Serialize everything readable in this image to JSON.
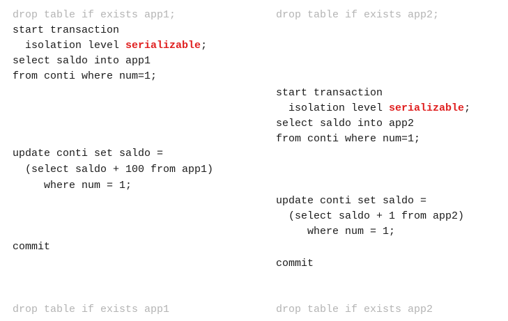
{
  "left": {
    "drop_top": "drop table if exists app1;",
    "start_transaction": "start transaction",
    "isolation_prefix": "  isolation level ",
    "isolation_keyword": "serializable",
    "isolation_suffix": ";",
    "select_into": "select saldo into app1",
    "from_where": "from conti where num=1;",
    "update": "update conti set saldo =",
    "subselect": "  (select saldo + 100 from app1)",
    "where": "     where num = 1;",
    "commit": "commit",
    "drop_bottom": "drop table if exists app1"
  },
  "right": {
    "drop_top": "drop table if exists app2;",
    "start_transaction": "start transaction",
    "isolation_prefix": "  isolation level ",
    "isolation_keyword": "serializable",
    "isolation_suffix": ";",
    "select_into": "select saldo into app2",
    "from_where": "from conti where num=1;",
    "update": "update conti set saldo =",
    "subselect": "  (select saldo + 1 from app2)",
    "where": "     where num = 1;",
    "commit": "commit",
    "drop_bottom": "drop table if exists app2"
  },
  "colors": {
    "keyword": "#e02020",
    "dim": "#b4b4b4",
    "text": "#1a1a1a"
  }
}
